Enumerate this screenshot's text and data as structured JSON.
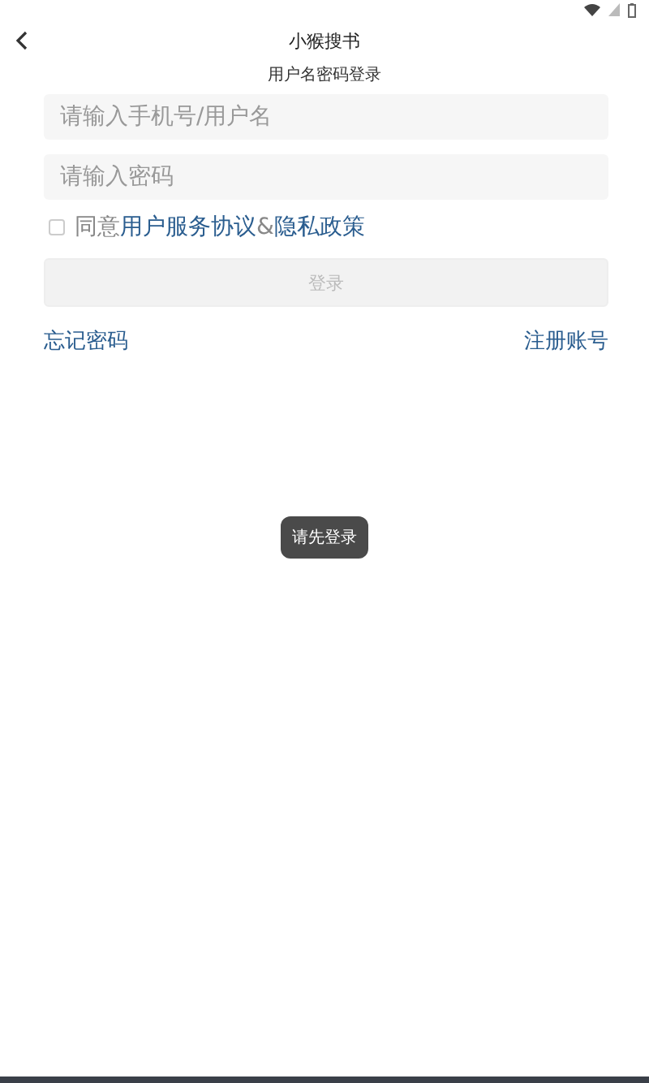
{
  "header": {
    "title": "小猴搜书",
    "subtitle": "用户名密码登录"
  },
  "fields": [
    {
      "placeholder": "请输入手机号/用户名"
    },
    {
      "placeholder": "请输入密码"
    }
  ],
  "agreement": {
    "checked": false,
    "prefix": "同意",
    "first_link": "用户服务协议",
    "separator": "&",
    "second_link": "隐私政策"
  },
  "login_button": {
    "label": "登录",
    "disabled": true
  },
  "links": {
    "forgot": "忘记密码",
    "register": "注册账号"
  },
  "toast": "请先登录"
}
